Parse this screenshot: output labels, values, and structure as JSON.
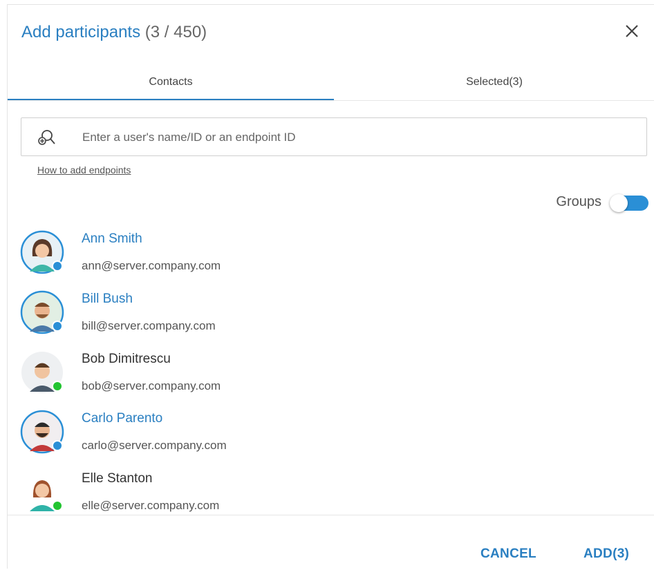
{
  "dialog": {
    "title": "Add participants",
    "count": "(3 / 450)",
    "close_icon": "close-icon"
  },
  "tabs": [
    {
      "label": "Contacts",
      "active": true
    },
    {
      "label": "Selected(3)",
      "active": false
    }
  ],
  "search": {
    "icon": "search-user-icon",
    "placeholder": "Enter a user's name/ID or an endpoint ID",
    "value": ""
  },
  "help_link": "How to add endpoints",
  "groups": {
    "label": "Groups",
    "toggle_state": "off"
  },
  "contacts": [
    {
      "name": "Ann Smith",
      "email": "ann@server.company.com",
      "selected": true,
      "status": "selected"
    },
    {
      "name": "Bill Bush",
      "email": "bill@server.company.com",
      "selected": true,
      "status": "selected"
    },
    {
      "name": "Bob Dimitrescu",
      "email": "bob@server.company.com",
      "selected": false,
      "status": "online"
    },
    {
      "name": "Carlo Parento",
      "email": "carlo@server.company.com",
      "selected": true,
      "status": "selected"
    },
    {
      "name": "Elle Stanton",
      "email": "elle@server.company.com",
      "selected": false,
      "status": "online"
    }
  ],
  "footer": {
    "cancel_label": "CANCEL",
    "add_label": "ADD(3)"
  },
  "colors": {
    "accent": "#2a7fc1",
    "online": "#22c431",
    "toggle": "#2a8fd6"
  }
}
